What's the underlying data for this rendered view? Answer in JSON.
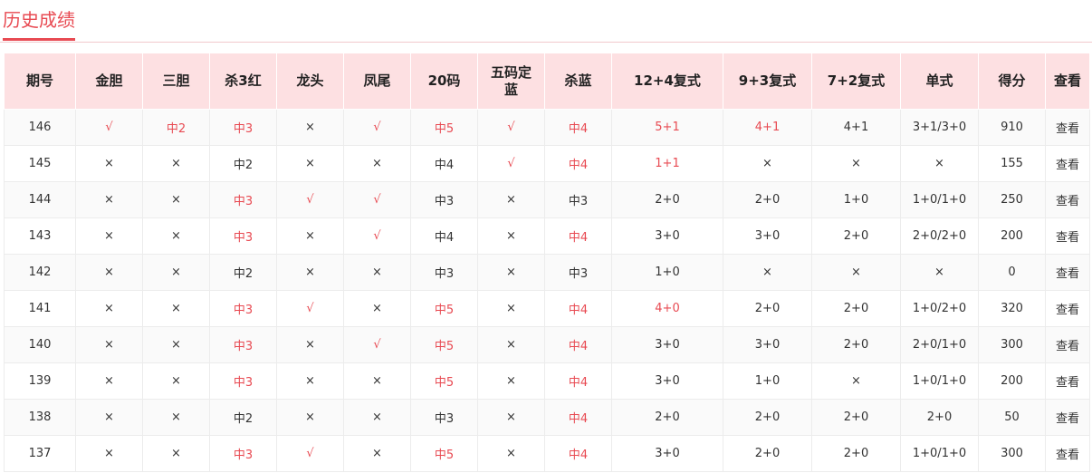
{
  "title": "历史成绩",
  "columns": [
    "期号",
    "金胆",
    "三胆",
    "杀3红",
    "龙头",
    "凤尾",
    "20码",
    "五码定蓝",
    "杀蓝",
    "12+4复式",
    "9+3复式",
    "7+2复式",
    "单式",
    "得分",
    "查看"
  ],
  "rows": [
    [
      "146",
      "√",
      "中2",
      "中3",
      "×",
      "√",
      "中5",
      "√",
      "中4",
      "5+1",
      "4+1",
      "4+1",
      "3+1/3+0",
      "910",
      "查看"
    ],
    [
      "145",
      "×",
      "×",
      "中2",
      "×",
      "×",
      "中4",
      "√",
      "中4",
      "1+1",
      "×",
      "×",
      "×",
      "155",
      "查看"
    ],
    [
      "144",
      "×",
      "×",
      "中3",
      "√",
      "√",
      "中3",
      "×",
      "中3",
      "2+0",
      "2+0",
      "1+0",
      "1+0/1+0",
      "250",
      "查看"
    ],
    [
      "143",
      "×",
      "×",
      "中3",
      "×",
      "√",
      "中4",
      "×",
      "中4",
      "3+0",
      "3+0",
      "2+0",
      "2+0/2+0",
      "200",
      "查看"
    ],
    [
      "142",
      "×",
      "×",
      "中2",
      "×",
      "×",
      "中3",
      "×",
      "中3",
      "1+0",
      "×",
      "×",
      "×",
      "0",
      "查看"
    ],
    [
      "141",
      "×",
      "×",
      "中3",
      "√",
      "×",
      "中5",
      "×",
      "中4",
      "4+0",
      "2+0",
      "2+0",
      "1+0/2+0",
      "320",
      "查看"
    ],
    [
      "140",
      "×",
      "×",
      "中3",
      "×",
      "√",
      "中5",
      "×",
      "中4",
      "3+0",
      "3+0",
      "2+0",
      "2+0/1+0",
      "300",
      "查看"
    ],
    [
      "139",
      "×",
      "×",
      "中3",
      "×",
      "×",
      "中5",
      "×",
      "中4",
      "3+0",
      "1+0",
      "×",
      "1+0/1+0",
      "200",
      "查看"
    ],
    [
      "138",
      "×",
      "×",
      "中2",
      "×",
      "×",
      "中3",
      "×",
      "中4",
      "2+0",
      "2+0",
      "2+0",
      "2+0",
      "50",
      "查看"
    ],
    [
      "137",
      "×",
      "×",
      "中3",
      "√",
      "×",
      "中5",
      "×",
      "中4",
      "3+0",
      "2+0",
      "2+0",
      "1+0/1+0",
      "300",
      "查看"
    ]
  ],
  "highlight_color": "#e84a52",
  "header_bg": "#fde0e2"
}
